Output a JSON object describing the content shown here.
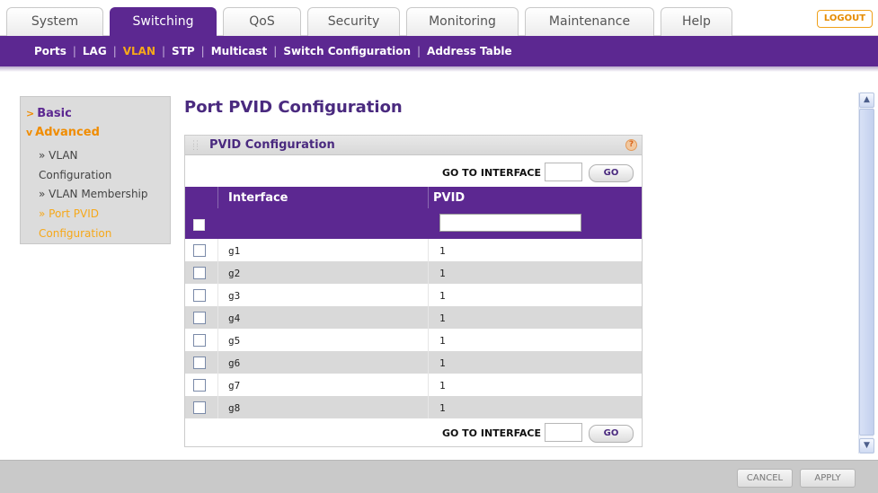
{
  "tabs": [
    {
      "label": "System",
      "active": false
    },
    {
      "label": "Switching",
      "active": true
    },
    {
      "label": "QoS",
      "active": false
    },
    {
      "label": "Security",
      "active": false
    },
    {
      "label": "Monitoring",
      "active": false
    },
    {
      "label": "Maintenance",
      "active": false
    },
    {
      "label": "Help",
      "active": false
    }
  ],
  "logout_label": "LOGOUT",
  "subnav": [
    {
      "label": "Ports",
      "active": false
    },
    {
      "label": "LAG",
      "active": false
    },
    {
      "label": "VLAN",
      "active": true
    },
    {
      "label": "STP",
      "active": false
    },
    {
      "label": "Multicast",
      "active": false
    },
    {
      "label": "Switch Configuration",
      "active": false
    },
    {
      "label": "Address Table",
      "active": false
    }
  ],
  "leftmenu": {
    "basic": "Basic",
    "advanced": "Advanced",
    "items": [
      {
        "label_1": "» VLAN",
        "label_2": "Configuration",
        "active": false
      },
      {
        "label_1": "» VLAN Membership",
        "active": false
      },
      {
        "label_1": "» Port PVID",
        "label_2": "Configuration",
        "active": true
      }
    ]
  },
  "page": {
    "title": "Port PVID Configuration",
    "panel_title": "PVID Configuration",
    "help_glyph": "?",
    "goto_label": "GO TO INTERFACE",
    "go_label": "GO",
    "columns": [
      "Interface",
      "PVID"
    ],
    "rows": [
      {
        "interface": "g1",
        "pvid": "1"
      },
      {
        "interface": "g2",
        "pvid": "1"
      },
      {
        "interface": "g3",
        "pvid": "1"
      },
      {
        "interface": "g4",
        "pvid": "1"
      },
      {
        "interface": "g5",
        "pvid": "1"
      },
      {
        "interface": "g6",
        "pvid": "1"
      },
      {
        "interface": "g7",
        "pvid": "1"
      },
      {
        "interface": "g8",
        "pvid": "1"
      }
    ]
  },
  "footer": {
    "cancel_label": "CANCEL",
    "apply_label": "APPLY"
  },
  "colors": {
    "brand_purple": "#5c2891",
    "accent_orange": "#f6a81a"
  }
}
